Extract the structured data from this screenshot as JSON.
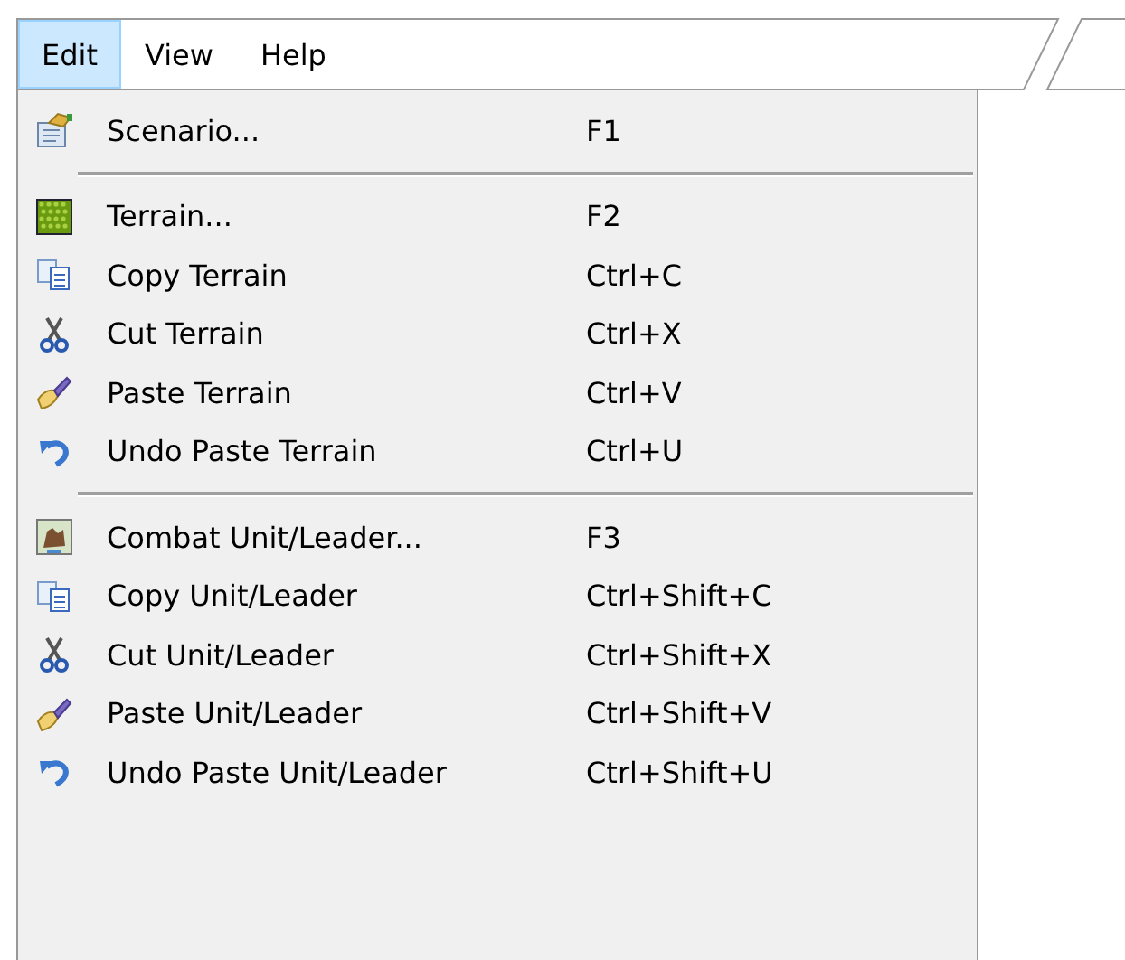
{
  "menu_bar": [
    {
      "label": "Edit",
      "selected": true
    },
    {
      "label": "View",
      "selected": false
    },
    {
      "label": "Help",
      "selected": false
    }
  ],
  "menu": [
    {
      "kind": "item",
      "label": "Scenario...",
      "shortcut": "F1"
    },
    {
      "kind": "separator"
    },
    {
      "kind": "item",
      "label": "Terrain...",
      "shortcut": "F2"
    },
    {
      "kind": "item",
      "label": "Copy Terrain",
      "shortcut": "Ctrl+C"
    },
    {
      "kind": "item",
      "label": "Cut Terrain",
      "shortcut": "Ctrl+X"
    },
    {
      "kind": "item",
      "label": "Paste Terrain",
      "shortcut": "Ctrl+V"
    },
    {
      "kind": "item",
      "label": "Undo Paste Terrain",
      "shortcut": "Ctrl+U"
    },
    {
      "kind": "separator"
    },
    {
      "kind": "item",
      "label": "Combat Unit/Leader...",
      "shortcut": "F3"
    },
    {
      "kind": "item",
      "label": "Copy Unit/Leader",
      "shortcut": "Ctrl+Shift+C"
    },
    {
      "kind": "item",
      "label": "Cut Unit/Leader",
      "shortcut": "Ctrl+Shift+X"
    },
    {
      "kind": "item",
      "label": "Paste Unit/Leader",
      "shortcut": "Ctrl+Shift+V"
    },
    {
      "kind": "item",
      "label": "Undo Paste Unit/Leader",
      "shortcut": "Ctrl+Shift+U"
    }
  ]
}
